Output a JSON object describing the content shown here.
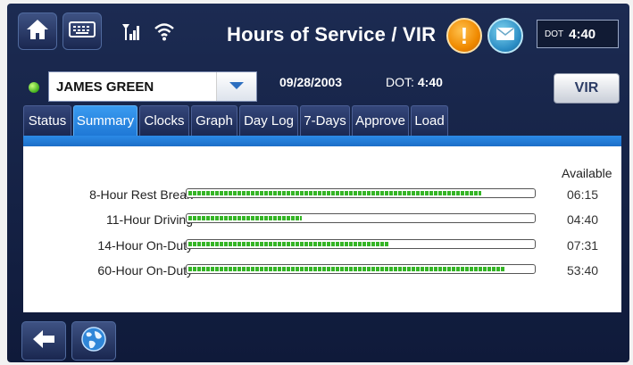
{
  "header": {
    "title": "Hours of Service / VIR",
    "dot_label": "DOT",
    "dot_value": "4:40",
    "icons": {
      "home": "home-icon",
      "keyboard": "keyboard-icon",
      "signal": "cellular-signal-icon",
      "wifi": "wifi-icon",
      "alert": "alert-icon",
      "mail": "mail-icon"
    },
    "alert_glyph": "!"
  },
  "driver": {
    "name": "JAMES GREEN",
    "date": "09/28/2003",
    "dot_label": "DOT:",
    "dot_value": "4:40",
    "status_color": "#3fae1b"
  },
  "vir_button": "VIR",
  "tabs": [
    {
      "label": "Status",
      "active": false
    },
    {
      "label": "Summary",
      "active": true
    },
    {
      "label": "Clocks",
      "active": false
    },
    {
      "label": "Graph",
      "active": false
    },
    {
      "label": "Day Log",
      "active": false
    },
    {
      "label": "7-Days",
      "active": false
    },
    {
      "label": "Approve",
      "active": false
    },
    {
      "label": "Load",
      "active": false
    }
  ],
  "summary": {
    "available_header": "Available",
    "rows": [
      {
        "label": "8-Hour Rest Break",
        "available": "06:15",
        "fraction": 0.85
      },
      {
        "label": "11-Hour Driving",
        "available": "04:40",
        "fraction": 0.33
      },
      {
        "label": "14-Hour On-Duty",
        "available": "07:31",
        "fraction": 0.58
      },
      {
        "label": "60-Hour On-Duty",
        "available": "53:40",
        "fraction": 0.92
      }
    ],
    "bar_color": "#35b526"
  },
  "footer": {
    "icons": {
      "back": "back-arrow-icon",
      "globe": "globe-icon"
    }
  }
}
